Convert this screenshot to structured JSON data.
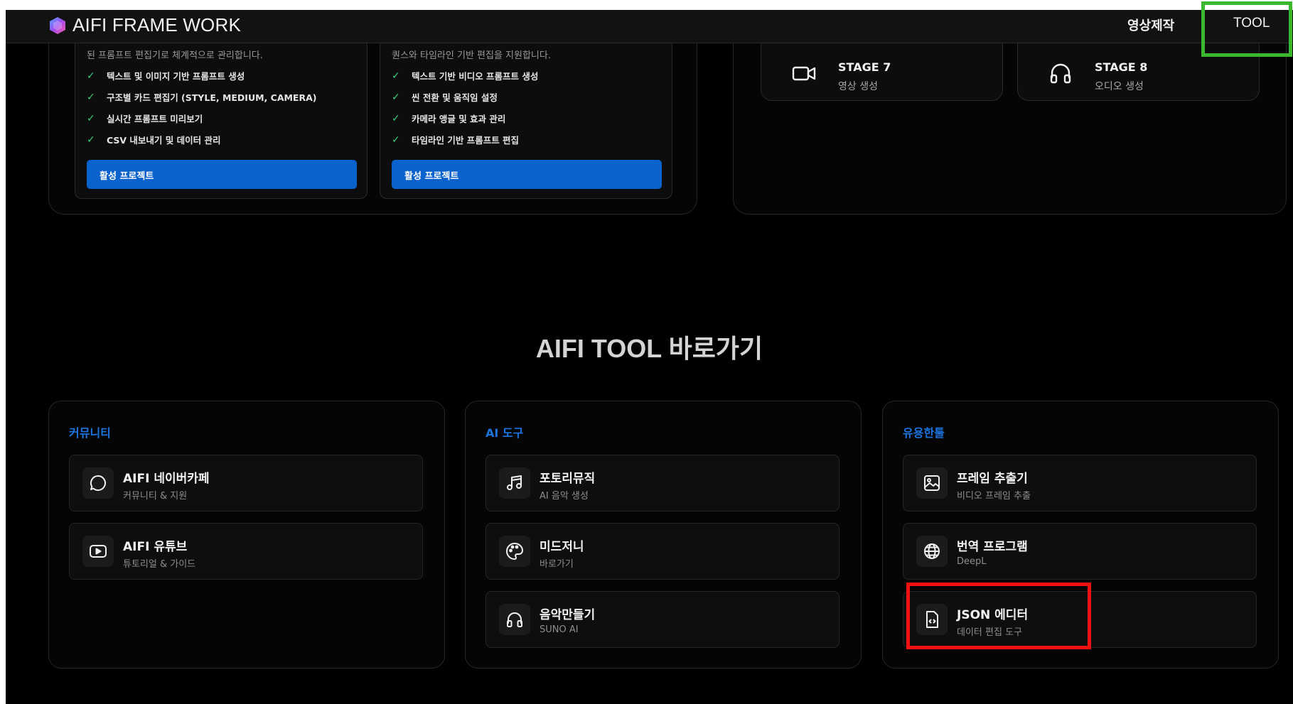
{
  "nav": {
    "brand": "AIFI FRAME WORK",
    "video_link": "영상제작",
    "tool_link": "TOOL"
  },
  "projects": [
    {
      "desc": "된 프롬프트 편집기로 체계적으로 관리합니다.",
      "features": [
        "텍스트 및 이미지 기반 프롬프트 생성",
        "구조별 카드 편집기 (STYLE, MEDIUM, CAMERA)",
        "실시간 프롬프트 미리보기",
        "CSV 내보내기 및 데이터 관리"
      ],
      "button": "활성 프로젝트"
    },
    {
      "desc": "퀀스와 타임라인 기반 편집을 지원합니다.",
      "features": [
        "텍스트 기반 비디오 프롬프트 생성",
        "씬 전환 및 움직임 설정",
        "카메라 앵글 및 효과 관리",
        "타임라인 기반 프롬프트 편집"
      ],
      "button": "활성 프로젝트"
    }
  ],
  "stages": [
    {
      "title": "STAGE 7",
      "sub": "영상 생성",
      "icon": "video-camera-icon"
    },
    {
      "title": "STAGE 8",
      "sub": "오디오 생성",
      "icon": "headphones-icon"
    }
  ],
  "tools_heading": "AIFI TOOL 바로가기",
  "columns": [
    {
      "title": "커뮤니티",
      "items": [
        {
          "title": "AIFI 네이버카페",
          "sub": "커뮤니티 & 지원",
          "icon": "chat-bubble-icon"
        },
        {
          "title": "AIFI 유튜브",
          "sub": "튜토리얼 & 가이드",
          "icon": "youtube-play-icon"
        }
      ]
    },
    {
      "title": "AI 도구",
      "items": [
        {
          "title": "포토리뮤직",
          "sub": "AI 음악 생성",
          "icon": "music-note-icon"
        },
        {
          "title": "미드저니",
          "sub": "바로가기",
          "icon": "palette-icon"
        },
        {
          "title": "음악만들기",
          "sub": "SUNO AI",
          "icon": "headphones-icon"
        }
      ]
    },
    {
      "title": "유용한툴",
      "items": [
        {
          "title": "프레임 추출기",
          "sub": "비디오 프레임 추출",
          "icon": "image-icon"
        },
        {
          "title": "번역 프로그램",
          "sub": "DeepL",
          "icon": "globe-icon"
        },
        {
          "title": "JSON 에디터",
          "sub": "데이터 편집 도구",
          "icon": "code-file-icon"
        }
      ]
    }
  ],
  "colors": {
    "background": "#000000",
    "accent_blue": "#0a62cc",
    "column_title": "#1c74e0",
    "check_green": "#3ccf7c",
    "highlight_green": "#3cb82e",
    "highlight_red": "#f21010"
  }
}
